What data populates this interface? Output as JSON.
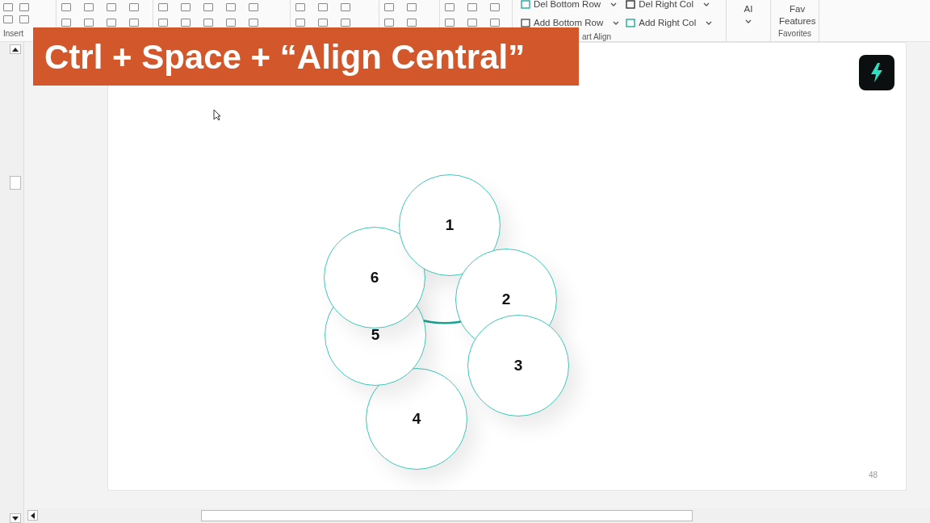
{
  "ribbon": {
    "insert_label": "Insert",
    "table_buttons": [
      {
        "label": "Del Bottom Row",
        "kind": "del-row"
      },
      {
        "label": "Del Right Col",
        "kind": "del-col"
      },
      {
        "label": "Add Bottom Row",
        "kind": "add-row"
      },
      {
        "label": "Add Right Col",
        "kind": "add-col"
      }
    ],
    "table_group_label": "art Align",
    "ai_button": "AI",
    "fav_button": "Fav Features",
    "fav_group_label": "Favorites"
  },
  "banner": "Ctrl + Space + “Align Central”",
  "slide": {
    "page_number": "48",
    "circles": [
      {
        "label": "4"
      },
      {
        "label": "5"
      },
      {
        "label": "6"
      },
      {
        "label": "1"
      },
      {
        "label": "2"
      },
      {
        "label": "3"
      }
    ]
  }
}
